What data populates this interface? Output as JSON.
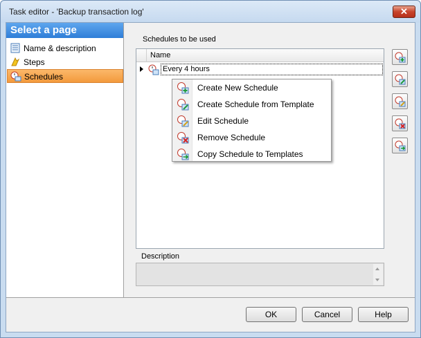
{
  "window": {
    "title": "Task editor - 'Backup transaction log'",
    "close_glyph": "✕"
  },
  "nav": {
    "header": "Select a page",
    "items": [
      {
        "label": "Name & description",
        "icon": "document-icon",
        "selected": false
      },
      {
        "label": "Steps",
        "icon": "steps-icon",
        "selected": false
      },
      {
        "label": "Schedules",
        "icon": "schedule-icon",
        "selected": true
      }
    ]
  },
  "main": {
    "schedules_label": "Schedules to be used",
    "grid": {
      "columns": [
        "Name"
      ],
      "rows": [
        {
          "name": "Every 4 hours"
        }
      ]
    },
    "description_label": "Description",
    "description_value": "",
    "side_buttons": [
      "add-schedule-icon",
      "add-from-template-icon",
      "edit-schedule-icon",
      "remove-schedule-icon",
      "copy-to-templates-icon"
    ]
  },
  "context_menu": {
    "items": [
      {
        "label": "Create New Schedule",
        "icon": "create-schedule-icon"
      },
      {
        "label": "Create Schedule from Template",
        "icon": "schedule-template-icon"
      },
      {
        "label": "Edit Schedule",
        "icon": "edit-schedule-icon"
      },
      {
        "label": "Remove Schedule",
        "icon": "remove-schedule-icon"
      },
      {
        "label": "Copy Schedule to Templates",
        "icon": "copy-schedule-icon"
      }
    ]
  },
  "buttons": {
    "ok": "OK",
    "cancel": "Cancel",
    "help": "Help"
  },
  "colors": {
    "accent": "#2f7ed8",
    "selected": "#f39a3c",
    "close": "#c7432a"
  }
}
